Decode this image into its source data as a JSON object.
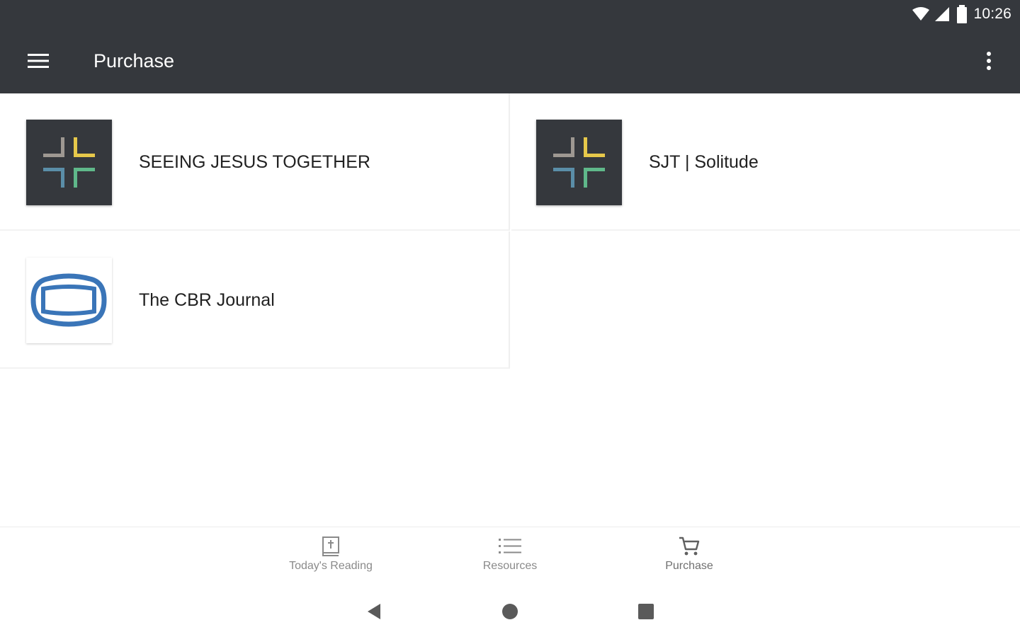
{
  "status_bar": {
    "time": "10:26",
    "icons": [
      "wifi-icon",
      "cell-signal-icon",
      "battery-icon"
    ]
  },
  "app_bar": {
    "title": "Purchase",
    "menu_icon": "hamburger-menu-icon",
    "overflow_icon": "more-vert-icon",
    "background": "#35383d"
  },
  "products": [
    {
      "name": "SEEING JESUS TOGETHER",
      "logo": "sjt-cross-logo"
    },
    {
      "name": "SJT | Solitude",
      "logo": "sjt-cross-logo"
    },
    {
      "name": "The CBR Journal",
      "logo": "cbr-journal-logo"
    }
  ],
  "bottom_nav": {
    "items": [
      {
        "label": "Today's Reading",
        "icon": "book-icon"
      },
      {
        "label": "Resources",
        "icon": "list-icon"
      },
      {
        "label": "Purchase",
        "icon": "cart-icon",
        "active": true
      }
    ]
  },
  "system_nav": {
    "buttons": [
      "back-icon",
      "home-icon",
      "recents-icon"
    ]
  },
  "colors": {
    "logo_gray": "#9e9892",
    "logo_yellow": "#e6c84a",
    "logo_blue": "#5a8ea8",
    "logo_green": "#5fb88a",
    "cbr_blue": "#3a75b8"
  }
}
